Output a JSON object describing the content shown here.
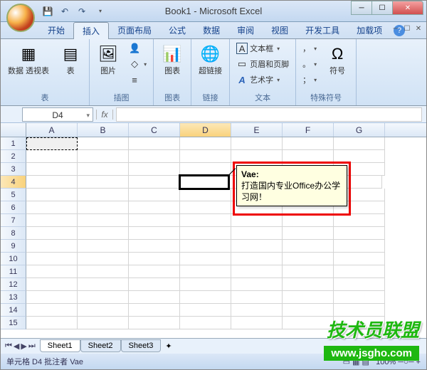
{
  "title": "Book1 - Microsoft Excel",
  "qat": {
    "save": "💾",
    "undo": "↶",
    "redo": "↷"
  },
  "tabs": [
    "开始",
    "插入",
    "页面布局",
    "公式",
    "数据",
    "审阅",
    "视图",
    "开发工具",
    "加载项"
  ],
  "active_tab_index": 1,
  "ribbon": {
    "groups": [
      {
        "label": "表",
        "items": [
          {
            "name": "pivot",
            "label": "数据\n透视表",
            "glyph": "▦"
          },
          {
            "name": "table",
            "label": "表",
            "glyph": "▤"
          }
        ]
      },
      {
        "label": "插图",
        "items": [
          {
            "name": "picture",
            "label": "图片",
            "glyph": "🖼"
          },
          {
            "name": "clipart",
            "label": "",
            "glyph": "👤"
          },
          {
            "name": "shapes",
            "label": "",
            "glyph": "◇"
          },
          {
            "name": "smartart",
            "label": "",
            "glyph": "≡"
          }
        ]
      },
      {
        "label": "图表",
        "items": [
          {
            "name": "chart",
            "label": "图表",
            "glyph": "📊"
          }
        ]
      },
      {
        "label": "链接",
        "items": [
          {
            "name": "hyperlink",
            "label": "超链接",
            "glyph": "🌐"
          }
        ]
      },
      {
        "label": "文本",
        "items": [
          {
            "name": "textbox",
            "label": "文本框",
            "glyph": "A"
          },
          {
            "name": "headerfooter",
            "label": "页眉和页脚",
            "glyph": "▭"
          },
          {
            "name": "wordart",
            "label": "艺术字",
            "glyph": "A"
          }
        ]
      },
      {
        "label": "特殊符号",
        "items": [
          {
            "name": "symbol",
            "label": "符号",
            "glyph": "Ω"
          },
          {
            "name": "comma",
            "label": "，",
            "glyph": "，"
          },
          {
            "name": "period",
            "label": "。",
            "glyph": "。"
          },
          {
            "name": "semicolon",
            "label": "；",
            "glyph": "；"
          }
        ]
      }
    ]
  },
  "name_box": "D4",
  "fx": "fx",
  "columns": [
    "A",
    "B",
    "C",
    "D",
    "E",
    "F",
    "G"
  ],
  "rows": [
    1,
    2,
    3,
    4,
    5,
    6,
    7,
    8,
    9,
    10,
    11,
    12,
    13,
    14,
    15
  ],
  "active_cell": {
    "row": 4,
    "col": "D"
  },
  "copied_cell": {
    "row": 1,
    "col": "A"
  },
  "comment": {
    "author": "Vae:",
    "text": "打造国内专业Office办公学习网！"
  },
  "sheets": [
    "Sheet1",
    "Sheet2",
    "Sheet3"
  ],
  "active_sheet_index": 0,
  "status_text": "单元格 D4 批注者 Vae",
  "zoom": "100%",
  "watermark1": "技术员联盟",
  "watermark2": "www.jsgho.com"
}
